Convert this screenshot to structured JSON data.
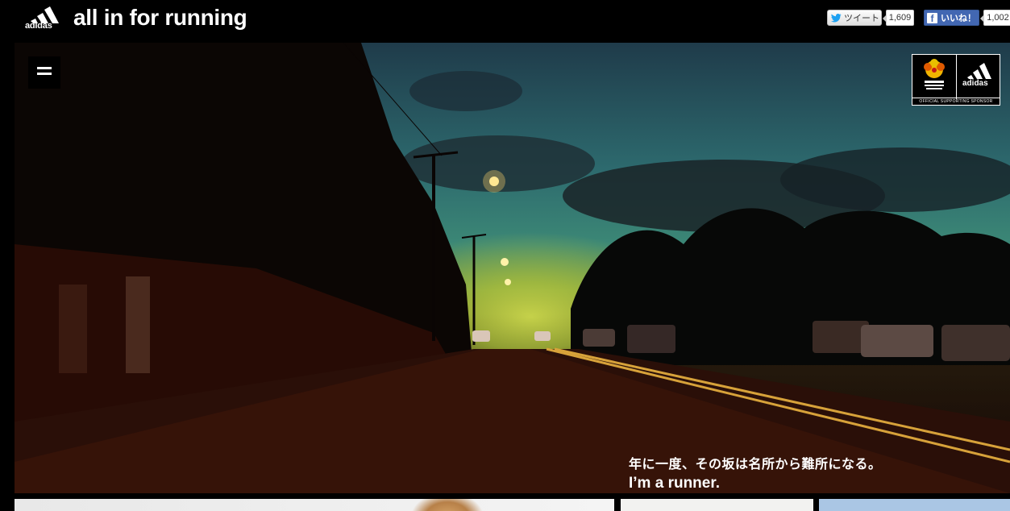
{
  "header": {
    "brand": "adidas",
    "title": "all in for running"
  },
  "social": {
    "tweet_label": "ツイート",
    "tweet_count": "1,609",
    "like_label": "いいね！",
    "like_count": "1,002",
    "colors": {
      "facebook": "#4267b2",
      "twitter": "#1da1f2"
    }
  },
  "hero": {
    "tagline_jp": "年に一度、その坂は名所から難所になる。",
    "tagline_en": "I’m a runner.",
    "menu_icon": "hamburger-icon",
    "sponsor": {
      "partner_icon": "honolulu-marathon-logo",
      "brand": "adidas",
      "caption": "OFFICIAL SUPPORTING SPONSOR"
    }
  }
}
